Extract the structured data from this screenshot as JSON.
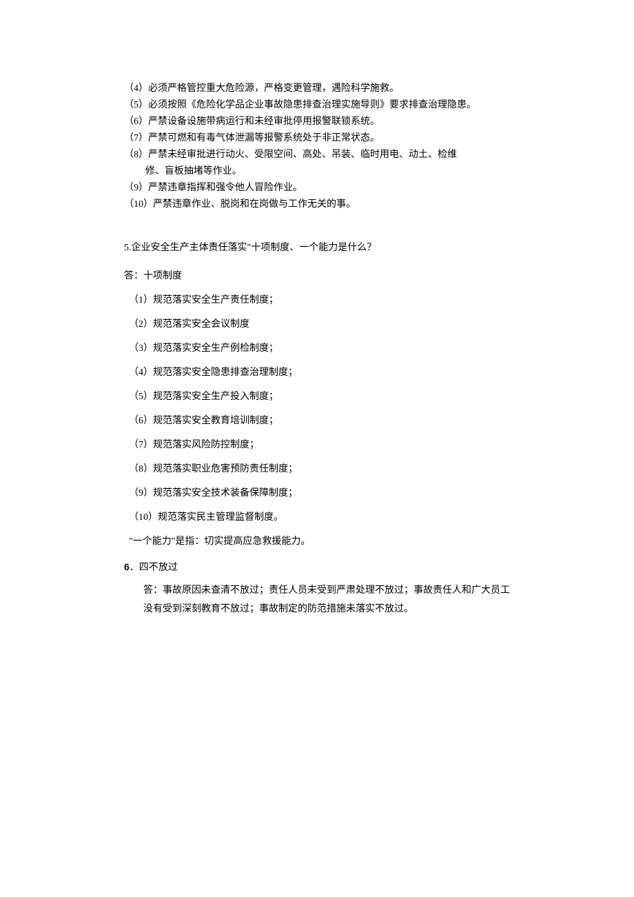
{
  "section4": {
    "items": [
      "（4）必须严格管控重大危险源，严格变更管理，遇险科学施救。",
      "（5）必须按照《危险化学品企业事故隐患排查治理实施导则》要求排查治理隐患。",
      "（6）严禁设备设施带病运行和未经审批停用报警联锁系统。",
      "（7）严禁可燃和有毒气体泄漏等报警系统处于非正常状态。",
      "（8）严禁未经审批进行动火、受限空间、高处、吊装、临时用电、动土、检维",
      "修、盲板抽堵等作业。",
      "（9）严禁违章指挥和强令他人冒险作业。",
      "（10）严禁违章作业、脱岗和在岗做与工作无关的事。"
    ]
  },
  "section5": {
    "question": "5.企业安全生产主体责任落实\"十项制度、一个能力是什么？",
    "answer_label": "答：十项制度",
    "items": [
      "（1）规范落实安全生产责任制度；",
      "（2）规范落实安全会议制度",
      "（3）规范落实安全生产例检制度；",
      "（4）规范落实安全隐患排查治理制度；",
      "（5）规范落实安全生产投入制度；",
      "（6）规范落实安全教育培训制度；",
      "（7）规范落实风险防控制度；",
      "（8）规范落实职业危害预防责任制度；",
      "（9）规范落实安全技术装备保障制度；",
      "（10）规范落实民主管理监督制度。"
    ],
    "ability": "\"一个能力\"是指：切实提高应急救援能力。"
  },
  "section6": {
    "number": "6",
    "title": "．四不放过",
    "answer": "答：事故原因未查清不放过；责任人员未受到严肃处理不放过；事故责任人和广大员工没有受到深刻教育不放过；事故制定的防范措施未落实不放过。"
  }
}
